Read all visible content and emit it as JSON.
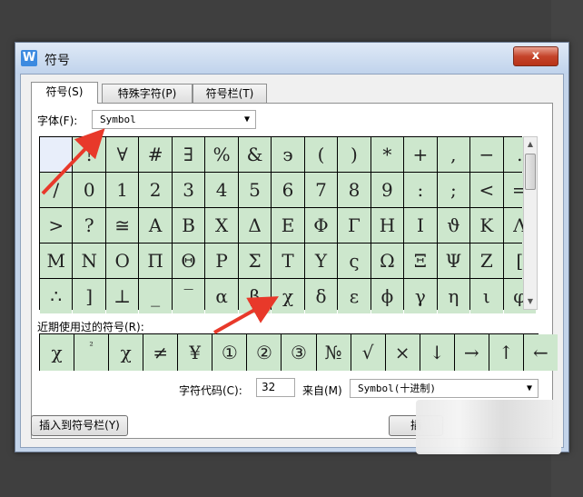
{
  "window": {
    "title": "符号",
    "app_icon": "W",
    "close_label": "x"
  },
  "tabs": [
    {
      "label": "符号(S)"
    },
    {
      "label": "特殊字符(P)"
    },
    {
      "label": "符号栏(T)"
    }
  ],
  "font": {
    "label": "字体(F):",
    "value": "Symbol"
  },
  "symbols": [
    "",
    "!",
    "∀",
    "#",
    "∃",
    "%",
    "&",
    "϶",
    "(",
    ")",
    "*",
    "+",
    ",",
    "−",
    ".",
    "/",
    "0",
    "1",
    "2",
    "3",
    "4",
    "5",
    "6",
    "7",
    "8",
    "9",
    ":",
    ";",
    "<",
    "=",
    ">",
    "?",
    "≅",
    "Α",
    "Β",
    "Χ",
    "Δ",
    "Ε",
    "Φ",
    "Γ",
    "Η",
    "Ι",
    "ϑ",
    "Κ",
    "Λ",
    "Μ",
    "Ν",
    "Ο",
    "Π",
    "Θ",
    "Ρ",
    "Σ",
    "Τ",
    "Υ",
    "ς",
    "Ω",
    "Ξ",
    "Ψ",
    "Ζ",
    "[",
    "∴",
    "]",
    "⊥",
    "_",
    "‾",
    "α",
    "β",
    "χ",
    "δ",
    "ε",
    "ϕ",
    "γ",
    "η",
    "ι",
    "φ"
  ],
  "recent": {
    "label": "近期使用过的符号(R):",
    "items": [
      "χ",
      "²",
      "χ",
      "≠",
      "¥",
      "①",
      "②",
      "③",
      "№",
      "√",
      "×",
      "↓",
      "→",
      "↑",
      "←"
    ]
  },
  "char_code": {
    "label": "字符代码(C):",
    "value": "32"
  },
  "from": {
    "label": "来自(M)",
    "value": "Symbol(十进制)"
  },
  "buttons": {
    "insert_to_bar": "插入到符号栏(Y)",
    "insert": "插"
  },
  "colors": {
    "cell_bg": "#cde7cd",
    "annotation_arrow": "#e8392a"
  }
}
